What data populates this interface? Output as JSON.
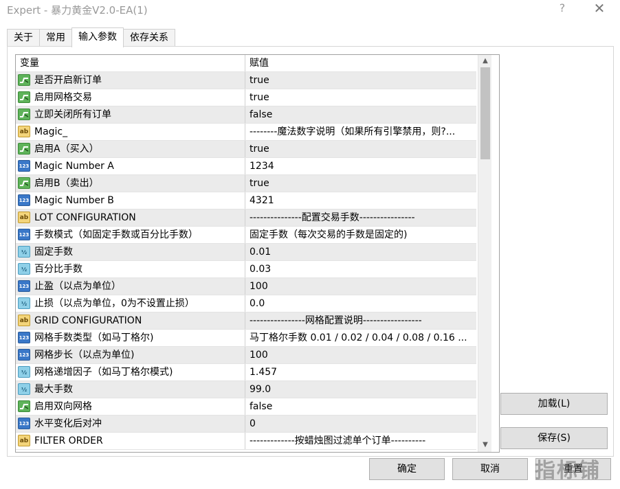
{
  "window": {
    "title": "Expert - 暴力黄金V2.0-EA(1)",
    "help_label": "?",
    "close_label": "✕"
  },
  "tabs": [
    {
      "label": "关于"
    },
    {
      "label": "常用"
    },
    {
      "label": "输入参数",
      "active": true
    },
    {
      "label": "依存关系"
    }
  ],
  "table": {
    "headers": {
      "name": "变量",
      "value": "赋值"
    },
    "rows": [
      {
        "type": "bool",
        "name": "是否开启新订单",
        "value": "true"
      },
      {
        "type": "bool",
        "name": "启用网格交易",
        "value": "true"
      },
      {
        "type": "bool",
        "name": "立即关闭所有订单",
        "value": "false"
      },
      {
        "type": "string",
        "name": "Magic_",
        "value": "--------魔法数字说明（如果所有引擎禁用，则?..."
      },
      {
        "type": "bool",
        "name": "启用A（买入）",
        "value": "true"
      },
      {
        "type": "int",
        "name": "Magic Number  A",
        "value": "1234"
      },
      {
        "type": "bool",
        "name": "启用B（卖出）",
        "value": "true"
      },
      {
        "type": "int",
        "name": "Magic Number  B",
        "value": "4321"
      },
      {
        "type": "string",
        "name": "LOT CONFIGURATION",
        "value": "---------------配置交易手数----------------"
      },
      {
        "type": "int",
        "name": "手数模式（如固定手数或百分比手数）",
        "value": "固定手数（每次交易的手数是固定的)"
      },
      {
        "type": "double",
        "name": "固定手数",
        "value": "0.01"
      },
      {
        "type": "double",
        "name": "百分比手数",
        "value": "0.03"
      },
      {
        "type": "int",
        "name": "止盈（以点为单位）",
        "value": "100"
      },
      {
        "type": "double",
        "name": "止损（以点为单位，0为不设置止损）",
        "value": "0.0"
      },
      {
        "type": "string",
        "name": "GRID CONFIGURATION",
        "value": "----------------网格配置说明-----------------"
      },
      {
        "type": "int",
        "name": "网格手数类型（如马丁格尔)",
        "value": "马丁格尔手数  0.01 / 0.02 / 0.04 / 0.08 / 0.16 ..."
      },
      {
        "type": "int",
        "name": "网格步长（以点为单位)",
        "value": "100"
      },
      {
        "type": "double",
        "name": "网格递增因子（如马丁格尔模式)",
        "value": "1.457"
      },
      {
        "type": "double",
        "name": "最大手数",
        "value": "99.0"
      },
      {
        "type": "bool",
        "name": "启用双向网格",
        "value": "false"
      },
      {
        "type": "int",
        "name": "水平变化后对冲",
        "value": "0"
      },
      {
        "type": "string",
        "name": "FILTER ORDER",
        "value": "-------------按蜡烛图过滤单个订单----------"
      }
    ]
  },
  "icons": {
    "bool": "bool-toggle-icon",
    "string": "ab-string-icon",
    "int": "123-integer-icon",
    "double": "half-double-icon"
  },
  "icon_glyphs": {
    "string": "ab",
    "int": "123",
    "double": "½"
  },
  "scroll": {
    "up": "▲",
    "down": "▼"
  },
  "buttons": {
    "load": "加载(L)",
    "save": "保存(S)",
    "ok": "确定",
    "cancel": "取消",
    "reset": "重置"
  },
  "watermark": "指标铺"
}
